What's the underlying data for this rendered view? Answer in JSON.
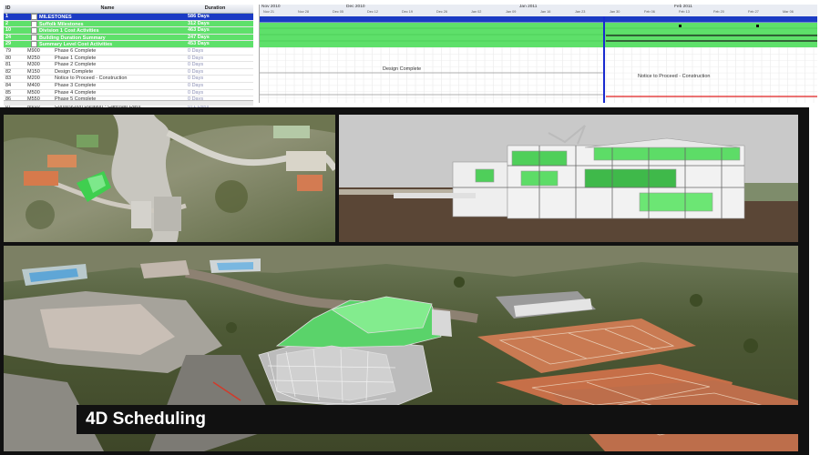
{
  "schedule": {
    "columns": {
      "id": "ID",
      "name": "Name",
      "duration": "Duration"
    },
    "rows": [
      {
        "id": "1",
        "name": "MILESTONES",
        "duration": "586 Days",
        "style": "sel",
        "exp": true
      },
      {
        "id": "2",
        "name": "Suffolk Milestones",
        "duration": "312 Days",
        "style": "grn",
        "exp": true
      },
      {
        "id": "10",
        "name": "Division 1 Cost Activities",
        "duration": "463 Days",
        "style": "grn",
        "exp": true
      },
      {
        "id": "24",
        "name": "Building Duration Summary",
        "duration": "247 Days",
        "style": "grn",
        "exp": true
      },
      {
        "id": "29",
        "name": "Summary Level Cost Activities",
        "duration": "453 Days",
        "style": "grn",
        "exp": true
      },
      {
        "id": "M900",
        "name": "Phase 6 Complete",
        "duration": "0 Days",
        "style": "plain"
      },
      {
        "id": "M250",
        "name": "Phase 1 Complete",
        "duration": "0 Days",
        "style": "plain"
      },
      {
        "id": "M300",
        "name": "Phase 2 Complete",
        "duration": "0 Days",
        "style": "plain"
      },
      {
        "id": "M150",
        "name": "Design Complete",
        "duration": "0 Days",
        "style": "plain"
      },
      {
        "id": "M200",
        "name": "Notice to Proceed - Construction",
        "duration": "0 Days",
        "style": "plain"
      },
      {
        "id": "M400",
        "name": "Phase 3 Complete",
        "duration": "0 Days",
        "style": "plain"
      },
      {
        "id": "M500",
        "name": "Phase 4 Complete",
        "duration": "0 Days",
        "style": "plain"
      },
      {
        "id": "M550",
        "name": "Phase 5 Complete",
        "duration": "0 Days",
        "style": "plain"
      },
      {
        "id": "M810",
        "name": "Construction Duration - Calendar Days",
        "duration": "671 Days",
        "style": "plain"
      }
    ],
    "row_ids_left": [
      "1",
      "2",
      "10",
      "24",
      "29",
      "79",
      "80",
      "81",
      "82",
      "83",
      "84",
      "85",
      "86",
      "87"
    ],
    "timeline": {
      "months": [
        "Nov 2010",
        "Dec 2010",
        "Jan 2011",
        "Feb 2011"
      ],
      "weeks": [
        "Nov 21",
        "Nov 28",
        "Dec 05",
        "Dec 12",
        "Dec 19",
        "Dec 26",
        "Jan 02",
        "Jan 09",
        "Jan 16",
        "Jan 23",
        "Jan 30",
        "Feb 06",
        "Feb 13",
        "Feb 20",
        "Feb 27",
        "Mar 06"
      ],
      "annotations": [
        "Design Complete",
        "Notice to Proceed - Construction"
      ]
    }
  },
  "caption": "4D Scheduling",
  "colors": {
    "selected": "#1b3bc4",
    "summary": "#5ee06a",
    "today_line": "#1a2bd0",
    "finish_line": "#e02020"
  }
}
